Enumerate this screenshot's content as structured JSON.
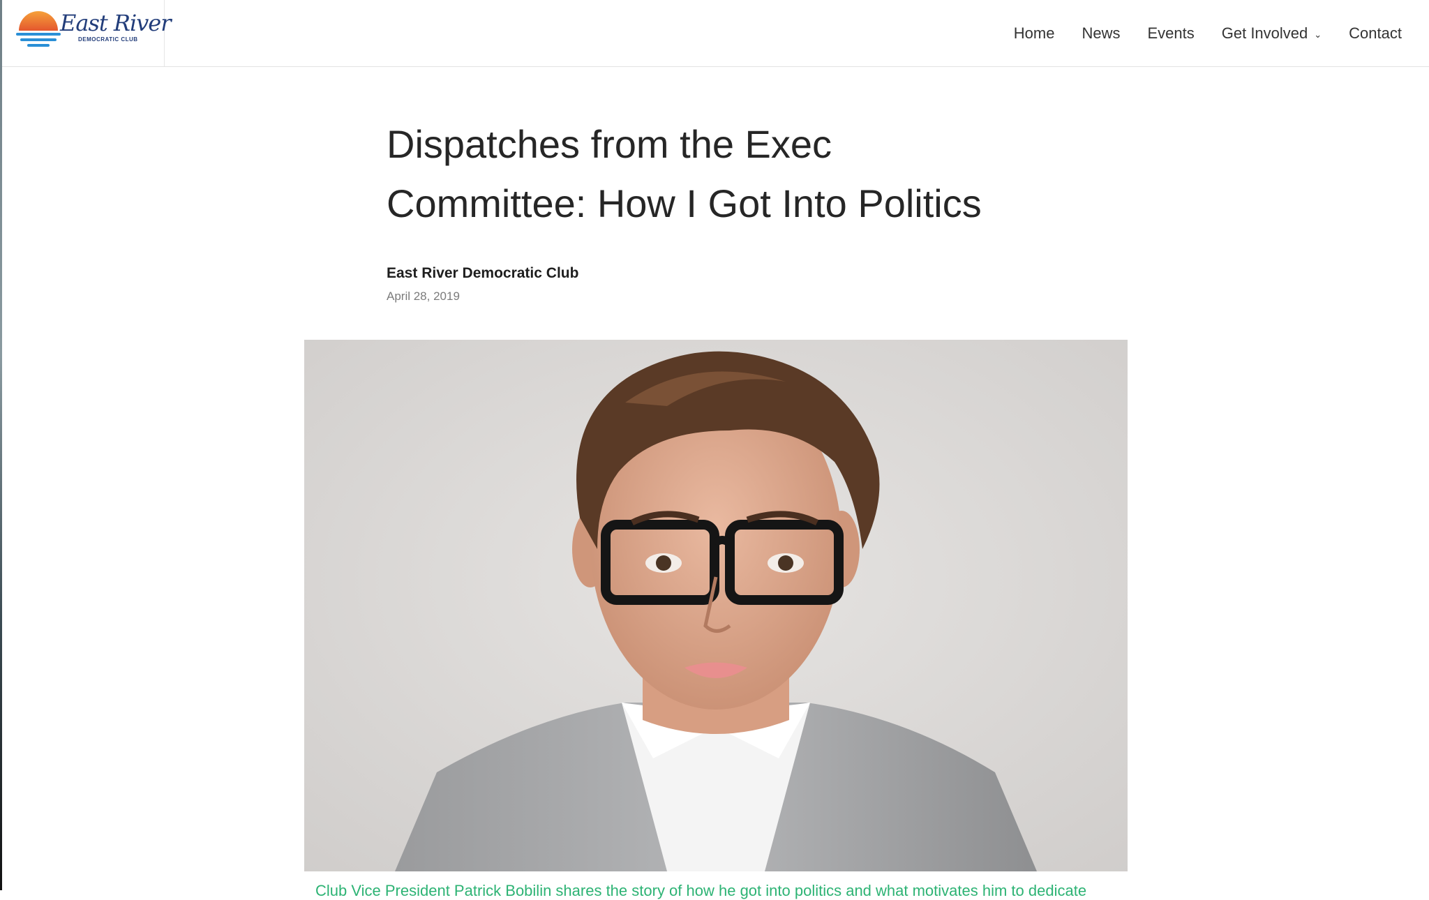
{
  "site": {
    "logo_name": "East River",
    "logo_subtitle": "DEMOCRATIC CLUB"
  },
  "nav": {
    "home": "Home",
    "news": "News",
    "events": "Events",
    "get_involved": "Get Involved",
    "contact": "Contact"
  },
  "article": {
    "title_line1": "Dispatches from the Exec",
    "title_line2": "Committee: How I Got Into Politics",
    "author": "East River Democratic Club",
    "date": "April 28, 2019",
    "caption": "Club Vice President Patrick Bobilin shares the story of how he got into politics and what motivates him to dedicate"
  },
  "colors": {
    "logo_blue": "#223d7a",
    "sun_orange": "#f28a2e",
    "water_blue": "#2a8fd6",
    "caption_green": "#2db374",
    "photo_background": "#dcdad8"
  },
  "icons": {
    "logo": "sunset-over-water-logo",
    "dropdown": "chevron-down-icon"
  }
}
